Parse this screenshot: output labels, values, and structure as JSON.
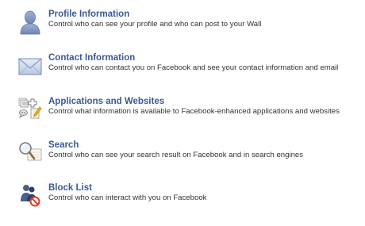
{
  "items": [
    {
      "title": "Profile Information",
      "description": "Control who can see your profile and who can post to your Wall",
      "icon": "person-silhouette-icon"
    },
    {
      "title": "Contact Information",
      "description": "Control who can contact you on Facebook and see your contact information and email",
      "icon": "envelope-icon"
    },
    {
      "title": "Applications and Websites",
      "description": "Control what information is available to Facebook-enhanced applications and websites",
      "icon": "applications-icon"
    },
    {
      "title": "Search",
      "description": "Control who can see your search result on Facebook and in search engines",
      "icon": "magnifier-icon"
    },
    {
      "title": "Block List",
      "description": "Control who can interact with you on Facebook",
      "icon": "block-list-icon"
    }
  ],
  "colors": {
    "link": "#3b5998",
    "text": "#333333"
  }
}
